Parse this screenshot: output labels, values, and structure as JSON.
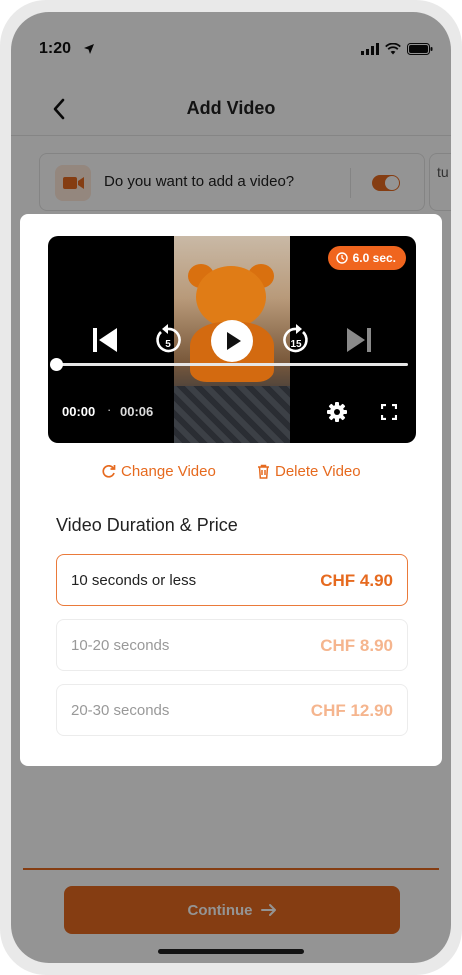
{
  "status_bar": {
    "time": "1:20"
  },
  "nav": {
    "title": "Add Video"
  },
  "question": {
    "text": "Do you want to add a video?",
    "toggle_on": true,
    "peek_text": "tu"
  },
  "player": {
    "duration_badge": "6.0 sec.",
    "current_time": "00:00",
    "separator": "·",
    "total_time": "00:06",
    "skip_back_seconds": "5",
    "skip_forward_seconds": "15",
    "progress": 0
  },
  "actions": {
    "change_label": "Change Video",
    "delete_label": "Delete Video"
  },
  "section_title": "Video Duration & Price",
  "options": [
    {
      "label": "10 seconds or less",
      "price": "CHF 4.90",
      "selected": true
    },
    {
      "label": "10-20 seconds",
      "price": "CHF 8.90",
      "selected": false
    },
    {
      "label": "20-30 seconds",
      "price": "CHF 12.90",
      "selected": false
    }
  ],
  "continue_label": "Continue",
  "colors": {
    "accent": "#e66a1f",
    "badge": "#f0651e"
  }
}
